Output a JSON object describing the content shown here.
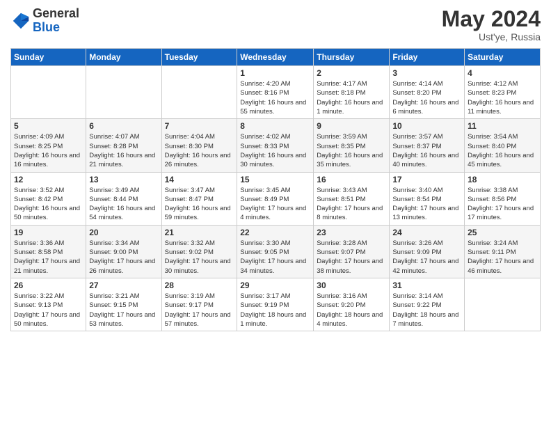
{
  "header": {
    "logo_general": "General",
    "logo_blue": "Blue",
    "month_title": "May 2024",
    "location": "Ust'ye, Russia"
  },
  "days_of_week": [
    "Sunday",
    "Monday",
    "Tuesday",
    "Wednesday",
    "Thursday",
    "Friday",
    "Saturday"
  ],
  "weeks": [
    {
      "days": [
        {
          "number": "",
          "sunrise": "",
          "sunset": "",
          "daylight": ""
        },
        {
          "number": "",
          "sunrise": "",
          "sunset": "",
          "daylight": ""
        },
        {
          "number": "",
          "sunrise": "",
          "sunset": "",
          "daylight": ""
        },
        {
          "number": "1",
          "sunrise": "Sunrise: 4:20 AM",
          "sunset": "Sunset: 8:16 PM",
          "daylight": "Daylight: 16 hours and 55 minutes."
        },
        {
          "number": "2",
          "sunrise": "Sunrise: 4:17 AM",
          "sunset": "Sunset: 8:18 PM",
          "daylight": "Daylight: 16 hours and 1 minute."
        },
        {
          "number": "3",
          "sunrise": "Sunrise: 4:14 AM",
          "sunset": "Sunset: 8:20 PM",
          "daylight": "Daylight: 16 hours and 6 minutes."
        },
        {
          "number": "4",
          "sunrise": "Sunrise: 4:12 AM",
          "sunset": "Sunset: 8:23 PM",
          "daylight": "Daylight: 16 hours and 11 minutes."
        }
      ]
    },
    {
      "days": [
        {
          "number": "5",
          "sunrise": "Sunrise: 4:09 AM",
          "sunset": "Sunset: 8:25 PM",
          "daylight": "Daylight: 16 hours and 16 minutes."
        },
        {
          "number": "6",
          "sunrise": "Sunrise: 4:07 AM",
          "sunset": "Sunset: 8:28 PM",
          "daylight": "Daylight: 16 hours and 21 minutes."
        },
        {
          "number": "7",
          "sunrise": "Sunrise: 4:04 AM",
          "sunset": "Sunset: 8:30 PM",
          "daylight": "Daylight: 16 hours and 26 minutes."
        },
        {
          "number": "8",
          "sunrise": "Sunrise: 4:02 AM",
          "sunset": "Sunset: 8:33 PM",
          "daylight": "Daylight: 16 hours and 30 minutes."
        },
        {
          "number": "9",
          "sunrise": "Sunrise: 3:59 AM",
          "sunset": "Sunset: 8:35 PM",
          "daylight": "Daylight: 16 hours and 35 minutes."
        },
        {
          "number": "10",
          "sunrise": "Sunrise: 3:57 AM",
          "sunset": "Sunset: 8:37 PM",
          "daylight": "Daylight: 16 hours and 40 minutes."
        },
        {
          "number": "11",
          "sunrise": "Sunrise: 3:54 AM",
          "sunset": "Sunset: 8:40 PM",
          "daylight": "Daylight: 16 hours and 45 minutes."
        }
      ]
    },
    {
      "days": [
        {
          "number": "12",
          "sunrise": "Sunrise: 3:52 AM",
          "sunset": "Sunset: 8:42 PM",
          "daylight": "Daylight: 16 hours and 50 minutes."
        },
        {
          "number": "13",
          "sunrise": "Sunrise: 3:49 AM",
          "sunset": "Sunset: 8:44 PM",
          "daylight": "Daylight: 16 hours and 54 minutes."
        },
        {
          "number": "14",
          "sunrise": "Sunrise: 3:47 AM",
          "sunset": "Sunset: 8:47 PM",
          "daylight": "Daylight: 16 hours and 59 minutes."
        },
        {
          "number": "15",
          "sunrise": "Sunrise: 3:45 AM",
          "sunset": "Sunset: 8:49 PM",
          "daylight": "Daylight: 17 hours and 4 minutes."
        },
        {
          "number": "16",
          "sunrise": "Sunrise: 3:43 AM",
          "sunset": "Sunset: 8:51 PM",
          "daylight": "Daylight: 17 hours and 8 minutes."
        },
        {
          "number": "17",
          "sunrise": "Sunrise: 3:40 AM",
          "sunset": "Sunset: 8:54 PM",
          "daylight": "Daylight: 17 hours and 13 minutes."
        },
        {
          "number": "18",
          "sunrise": "Sunrise: 3:38 AM",
          "sunset": "Sunset: 8:56 PM",
          "daylight": "Daylight: 17 hours and 17 minutes."
        }
      ]
    },
    {
      "days": [
        {
          "number": "19",
          "sunrise": "Sunrise: 3:36 AM",
          "sunset": "Sunset: 8:58 PM",
          "daylight": "Daylight: 17 hours and 21 minutes."
        },
        {
          "number": "20",
          "sunrise": "Sunrise: 3:34 AM",
          "sunset": "Sunset: 9:00 PM",
          "daylight": "Daylight: 17 hours and 26 minutes."
        },
        {
          "number": "21",
          "sunrise": "Sunrise: 3:32 AM",
          "sunset": "Sunset: 9:02 PM",
          "daylight": "Daylight: 17 hours and 30 minutes."
        },
        {
          "number": "22",
          "sunrise": "Sunrise: 3:30 AM",
          "sunset": "Sunset: 9:05 PM",
          "daylight": "Daylight: 17 hours and 34 minutes."
        },
        {
          "number": "23",
          "sunrise": "Sunrise: 3:28 AM",
          "sunset": "Sunset: 9:07 PM",
          "daylight": "Daylight: 17 hours and 38 minutes."
        },
        {
          "number": "24",
          "sunrise": "Sunrise: 3:26 AM",
          "sunset": "Sunset: 9:09 PM",
          "daylight": "Daylight: 17 hours and 42 minutes."
        },
        {
          "number": "25",
          "sunrise": "Sunrise: 3:24 AM",
          "sunset": "Sunset: 9:11 PM",
          "daylight": "Daylight: 17 hours and 46 minutes."
        }
      ]
    },
    {
      "days": [
        {
          "number": "26",
          "sunrise": "Sunrise: 3:22 AM",
          "sunset": "Sunset: 9:13 PM",
          "daylight": "Daylight: 17 hours and 50 minutes."
        },
        {
          "number": "27",
          "sunrise": "Sunrise: 3:21 AM",
          "sunset": "Sunset: 9:15 PM",
          "daylight": "Daylight: 17 hours and 53 minutes."
        },
        {
          "number": "28",
          "sunrise": "Sunrise: 3:19 AM",
          "sunset": "Sunset: 9:17 PM",
          "daylight": "Daylight: 17 hours and 57 minutes."
        },
        {
          "number": "29",
          "sunrise": "Sunrise: 3:17 AM",
          "sunset": "Sunset: 9:19 PM",
          "daylight": "Daylight: 18 hours and 1 minute."
        },
        {
          "number": "30",
          "sunrise": "Sunrise: 3:16 AM",
          "sunset": "Sunset: 9:20 PM",
          "daylight": "Daylight: 18 hours and 4 minutes."
        },
        {
          "number": "31",
          "sunrise": "Sunrise: 3:14 AM",
          "sunset": "Sunset: 9:22 PM",
          "daylight": "Daylight: 18 hours and 7 minutes."
        },
        {
          "number": "",
          "sunrise": "",
          "sunset": "",
          "daylight": ""
        }
      ]
    }
  ]
}
